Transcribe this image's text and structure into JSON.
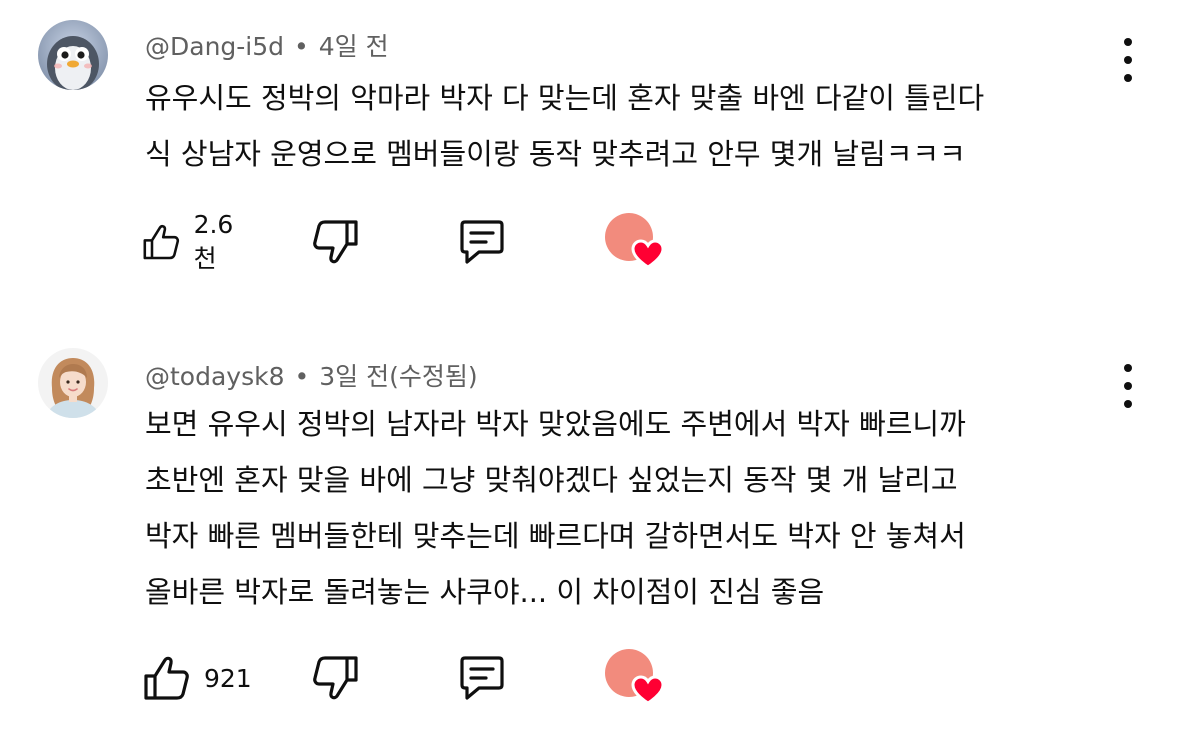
{
  "comments": [
    {
      "author": "@Dang-i5d",
      "separator": "•",
      "time": "4일 전",
      "text_lines": [
        "유우시도 정박의 악마라 박자 다 맞는데 혼자 맞출 바엔 다같이 틀린다",
        "식 상남자 운영으로 멤버들이랑 동작 맞추려고 안무 몇개 날림ㅋㅋㅋ"
      ],
      "like_count": "2.6천",
      "avatar_icon": "penguin-avatar",
      "heart_color": "#ff0033",
      "creator_avatar_color": "#f28b7d"
    },
    {
      "author": "@todaysk8",
      "separator": "•",
      "time": "3일 전(수정됨)",
      "text_lines": [
        "보면 유우시 정박의 남자라 박자 맞았음에도 주변에서 박자 빠르니까",
        "초반엔 혼자 맞을 바에 그냥 맞춰야겠다 싶었는지 동작 몇 개 날리고",
        "박자 빠른 멤버들한테 맞추는데 빠르다며 갈하면서도 박자 안 놓쳐서",
        "올바른 박자로 돌려놓는 사쿠야... 이 차이점이 진심 좋음"
      ],
      "like_count": "921",
      "avatar_icon": "woman-avatar",
      "heart_color": "#ff0033",
      "creator_avatar_color": "#f28b7d"
    }
  ],
  "icons": {
    "like": "thumbs-up-icon",
    "dislike": "thumbs-down-icon",
    "reply": "comment-icon",
    "menu": "more-vert-icon",
    "heart": "creator-heart-icon"
  }
}
